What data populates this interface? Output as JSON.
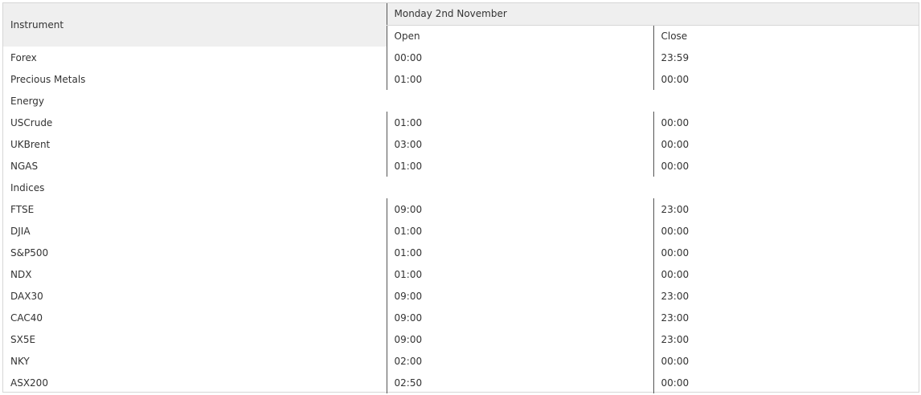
{
  "table": {
    "instrument_header": "Instrument",
    "date_header": "Monday 2nd November",
    "open_header": "Open",
    "close_header": "Close",
    "rows": [
      {
        "kind": "row",
        "instrument": "Forex",
        "open": "00:00",
        "close": "23:59"
      },
      {
        "kind": "row",
        "instrument": "Precious Metals",
        "open": "01:00",
        "close": "00:00"
      },
      {
        "kind": "section",
        "label": "Energy"
      },
      {
        "kind": "row",
        "instrument": "USCrude",
        "open": "01:00",
        "close": "00:00"
      },
      {
        "kind": "row",
        "instrument": "UKBrent",
        "open": "03:00",
        "close": "00:00"
      },
      {
        "kind": "row",
        "instrument": "NGAS",
        "open": "01:00",
        "close": "00:00"
      },
      {
        "kind": "section",
        "label": "Indices"
      },
      {
        "kind": "row",
        "instrument": "FTSE",
        "open": "09:00",
        "close": "23:00"
      },
      {
        "kind": "row",
        "instrument": "DJIA",
        "open": "01:00",
        "close": "00:00"
      },
      {
        "kind": "row",
        "instrument": "S&P500",
        "open": "01:00",
        "close": "00:00"
      },
      {
        "kind": "row",
        "instrument": "NDX",
        "open": "01:00",
        "close": "00:00"
      },
      {
        "kind": "row",
        "instrument": "DAX30",
        "open": "09:00",
        "close": "23:00"
      },
      {
        "kind": "row",
        "instrument": "CAC40",
        "open": "09:00",
        "close": "23:00"
      },
      {
        "kind": "row",
        "instrument": "SX5E",
        "open": "09:00",
        "close": "23:00"
      },
      {
        "kind": "row",
        "instrument": "NKY",
        "open": "02:00",
        "close": "00:00"
      },
      {
        "kind": "row",
        "instrument": "ASX200",
        "open": "02:50",
        "close": "00:00"
      }
    ]
  }
}
